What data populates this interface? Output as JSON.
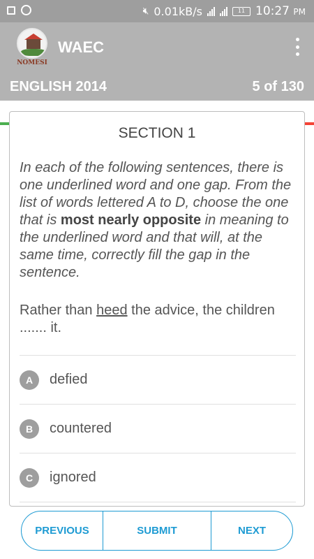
{
  "status_bar": {
    "net_speed": "0.01kB/s",
    "battery": "11",
    "time": "10:27",
    "time_suffix": "PM"
  },
  "app_bar": {
    "title": "WAEC",
    "logo_text": "NOMESI",
    "subject": "ENGLISH 2014",
    "page_count": "5 of 130",
    "strip_colors": [
      "#4caf50",
      "#ff9800",
      "#2196f3",
      "#f44336"
    ]
  },
  "question": {
    "section": "SECTION 1",
    "instruction_part1": "In each of the following sentences, there is one underlined word and one gap. From the list of words lettered A to D, choose the one that is ",
    "instruction_bold": "most nearly opposite",
    "instruction_part2": " in meaning to the underlined word and that will, at the same time, correctly fill the gap in the sentence.",
    "text_before": "Rather than ",
    "text_underlined": "heed",
    "text_after": " the advice, the children ....... it.",
    "options": [
      {
        "letter": "A",
        "text": "defied"
      },
      {
        "letter": "B",
        "text": "countered"
      },
      {
        "letter": "C",
        "text": "ignored"
      }
    ]
  },
  "buttons": {
    "previous": "PREVIOUS",
    "submit": "SUBMIT",
    "next": "NEXT"
  },
  "colors": {
    "accent": "#1e9bd3",
    "app_bar": "#b3b3b3",
    "status_bar": "#9e9e9e"
  }
}
